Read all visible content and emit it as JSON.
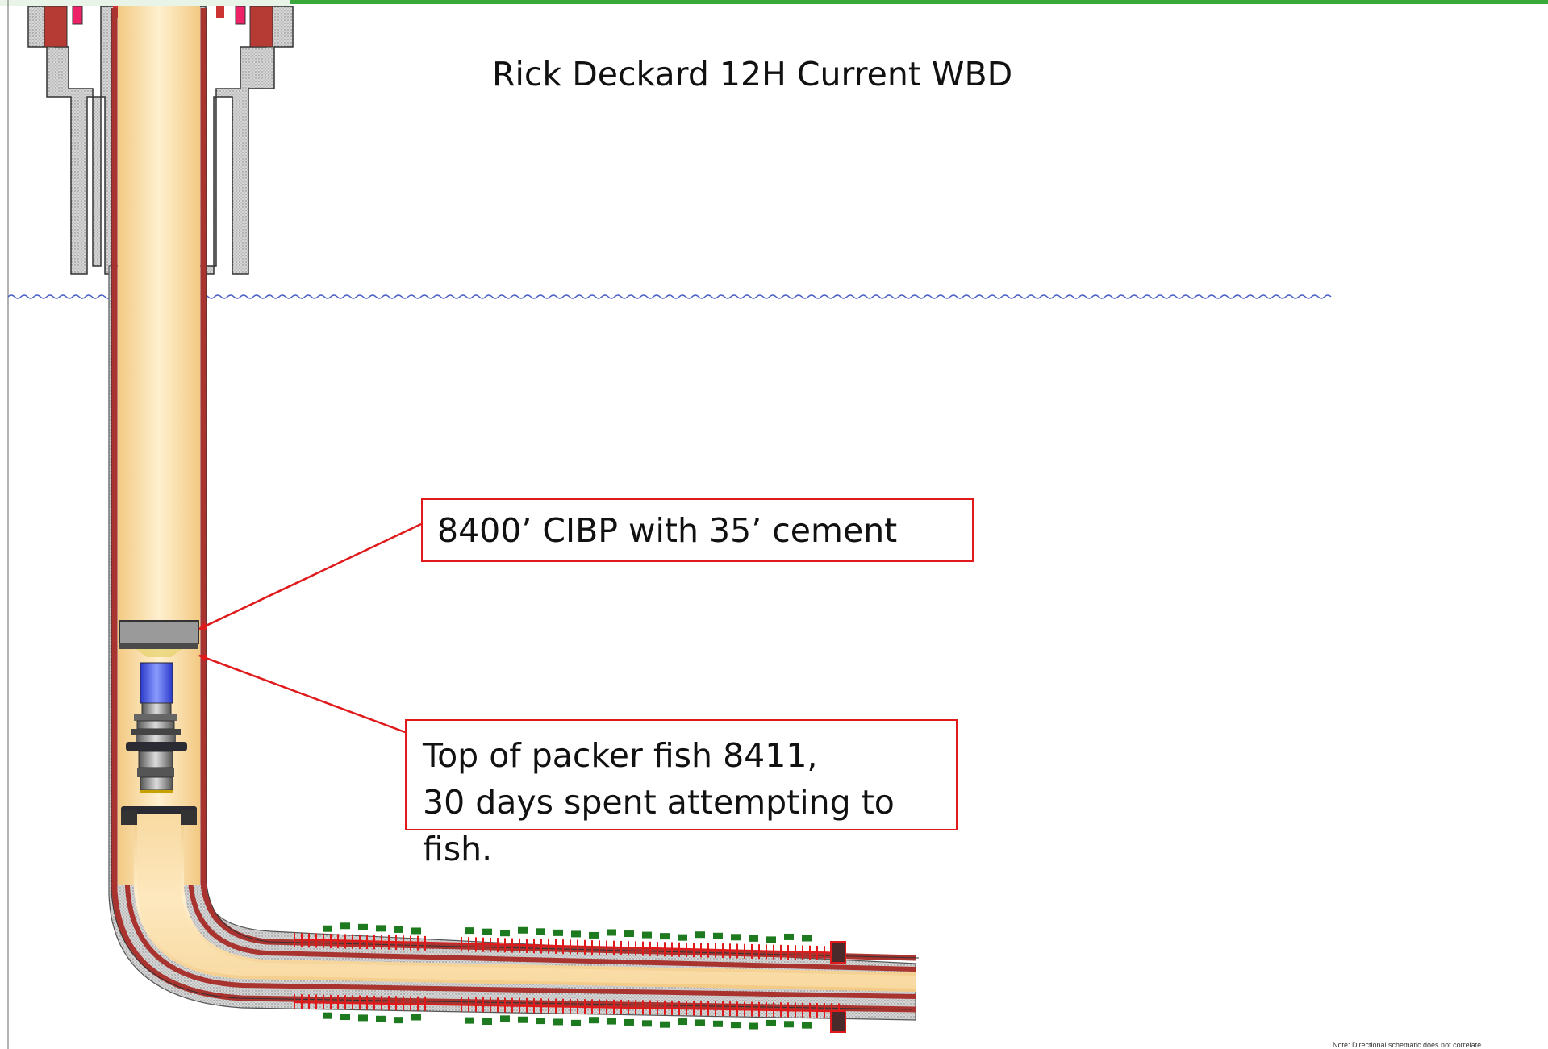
{
  "title": "Rick Deckard 12H Current WBD",
  "callouts": {
    "cibp": "8400’ CIBP with 35’ cement",
    "fish_line1": "Top of packer fish 8411,",
    "fish_line2": "30 days spent attempting to fish."
  },
  "note": "Note: Directional schematic does not correlate",
  "colors": {
    "callout_border": "#e0191b",
    "arrow": "#e0191b",
    "casing": "#a9332f",
    "cement": "#cfcfcf",
    "tubing_fill": "#f8d9a0",
    "ground_line": "#4a5fc6",
    "perforation": "#1e7a1e",
    "top_border": "#3aa83a"
  }
}
